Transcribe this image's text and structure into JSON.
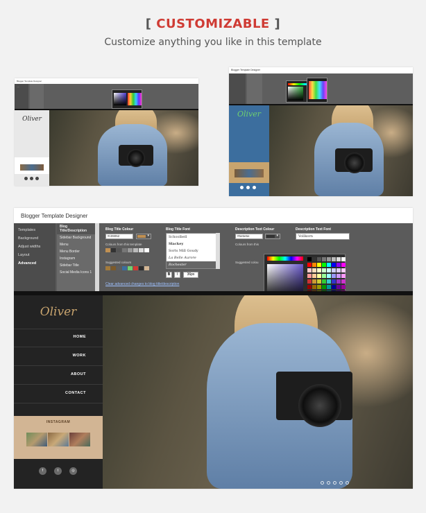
{
  "header": {
    "bracket_open": "[",
    "title": "CUSTOMIZABLE",
    "bracket_close": "]",
    "subtitle": "Customize anything you like in this template"
  },
  "designer": {
    "app_title": "Blogger Template Designer",
    "nav": [
      "Templates",
      "Background",
      "Adjust widths",
      "Layout",
      "Advanced"
    ],
    "nav_active": "Advanced",
    "sub_nav": [
      "Blog Title/Description",
      "Sidebar Background",
      "Menu",
      "Menu Border",
      "Instagram",
      "Sidebar Title",
      "Social Media Icons 1"
    ],
    "sub_nav_active": "Blog Title/Description",
    "blog_title_colour": {
      "label": "Blog Title Colour",
      "value": "#c09052",
      "swatch": "#c09052",
      "from_template_label": "Colours from this template",
      "suggested_label": "Suggested colours"
    },
    "blog_title_font": {
      "label": "Blog Title Font",
      "fonts": [
        "Schoolbell",
        "Slackey",
        "Sorts Mill Goudy",
        "La Belle Aurore",
        "Rochester"
      ],
      "selected": "Rochester",
      "bold": "B",
      "italic": "I",
      "size": "36px"
    },
    "description_text_colour": {
      "label": "Description Text Colour",
      "value": "#5e5e5e",
      "swatch": "#333333",
      "from_template_label": "Colours from this",
      "suggested_label": "Suggested colou"
    },
    "description_text_font": {
      "label": "Description Text Font",
      "selected": "Vollkorn"
    },
    "palette": {
      "transparent_label": "Transparent"
    },
    "advanced_link": "Clear advanced changes to blog title/description"
  },
  "blog_preview": {
    "logo": "Oliver",
    "menu": [
      "HOME",
      "WORK",
      "ABOUT",
      "CONTACT"
    ],
    "instagram_label": "INSTAGRAM",
    "social_icons": [
      "facebook-icon",
      "twitter-icon",
      "instagram-icon"
    ],
    "social_glyphs": [
      "f",
      "t",
      "◎"
    ],
    "slider_dots": 5
  },
  "colors": {
    "accent": "#cf3b34",
    "designer_bg": "#5b5b5b",
    "sidebar_bg": "#232323",
    "sidebar_blue": "#3c6e9e",
    "logo_gold": "#c8a46e",
    "logo_green": "#6fcf6f",
    "instagram_bg": "#d2b594"
  }
}
